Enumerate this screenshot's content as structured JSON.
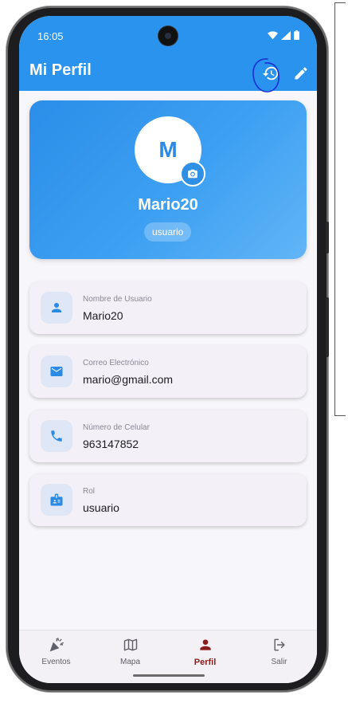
{
  "status_bar": {
    "time": "16:05"
  },
  "app_bar": {
    "title": "Mi Perfil",
    "history_icon": "history-icon",
    "edit_icon": "edit-icon"
  },
  "profile": {
    "avatar_letter": "M",
    "username": "Mario20",
    "role": "usuario"
  },
  "info_items": [
    {
      "icon": "person-icon",
      "label": "Nombre de Usuario",
      "value": "Mario20"
    },
    {
      "icon": "email-icon",
      "label": "Correo Electrónico",
      "value": "mario@gmail.com"
    },
    {
      "icon": "phone-icon",
      "label": "Número de Celular",
      "value": "963147852"
    },
    {
      "icon": "badge-icon",
      "label": "Rol",
      "value": "usuario"
    }
  ],
  "nav": [
    {
      "label": "Eventos",
      "icon": "party-icon",
      "active": false
    },
    {
      "label": "Mapa",
      "icon": "map-icon",
      "active": false
    },
    {
      "label": "Perfil",
      "icon": "person-icon",
      "active": true
    },
    {
      "label": "Salir",
      "icon": "logout-icon",
      "active": false
    }
  ],
  "colors": {
    "primary": "#2a93ee",
    "active_nav": "#8a1c1c",
    "card_bg": "#f3f0f7",
    "annotation": "#1a2fd1"
  }
}
